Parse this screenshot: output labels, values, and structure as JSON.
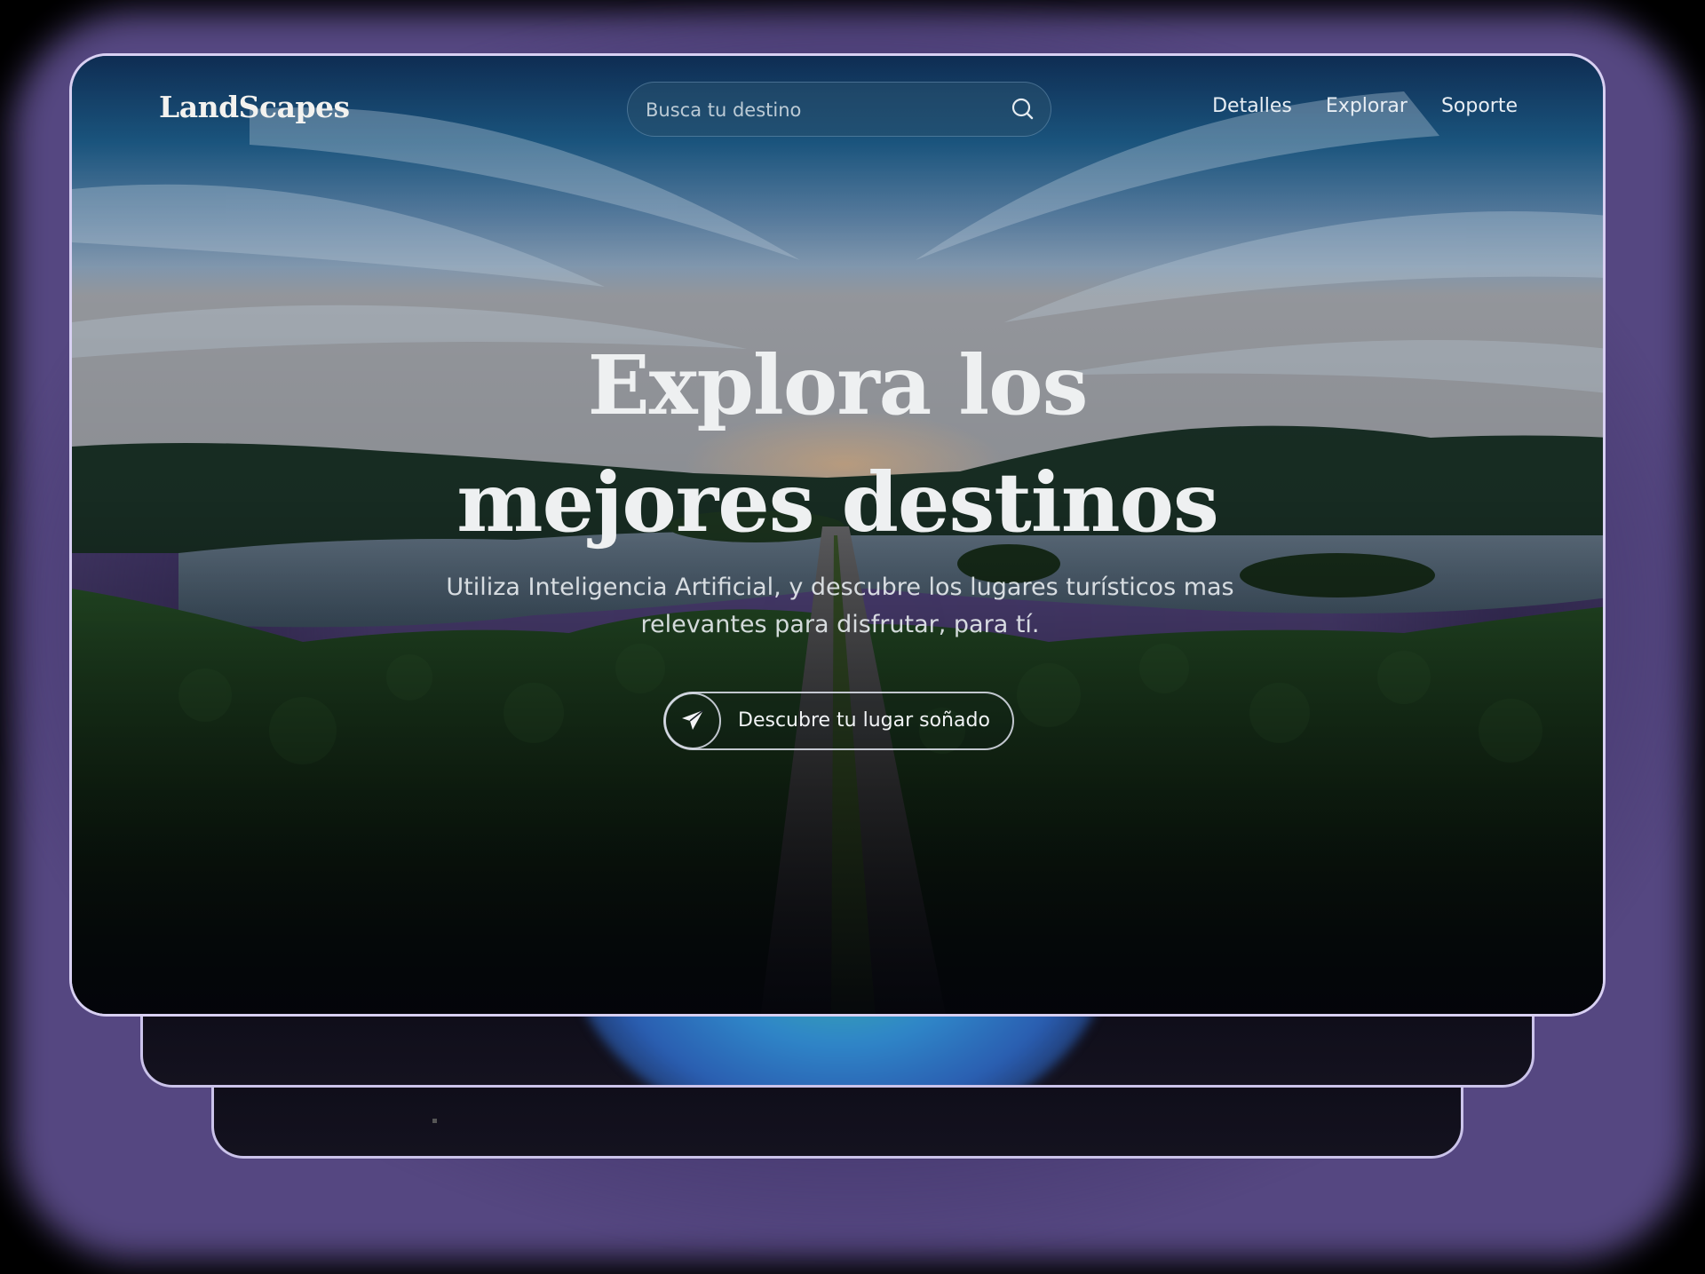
{
  "header": {
    "logo": "LandScapes",
    "search_placeholder": "Busca tu destino",
    "nav": [
      {
        "label": "Detalles"
      },
      {
        "label": "Explorar"
      },
      {
        "label": "Soporte"
      }
    ]
  },
  "hero": {
    "title_line1": "Explora los",
    "title_line2": "mejores destinos",
    "subtitle_line1": "Utiliza Inteligencia Artificial, y descubre los lugares turísticos mas",
    "subtitle_line2": "relevantes para disfrutar, para tí.",
    "cta_label": "Descubre tu lugar soñado",
    "cta_icon": "paper-plane-icon"
  },
  "colors": {
    "frame_border": "#d8d0f2",
    "backdrop_glow": "#5a4b88",
    "text_light": "#eef0f1",
    "accent_teal": "#3bb79d",
    "accent_blue": "#2f86c8"
  }
}
